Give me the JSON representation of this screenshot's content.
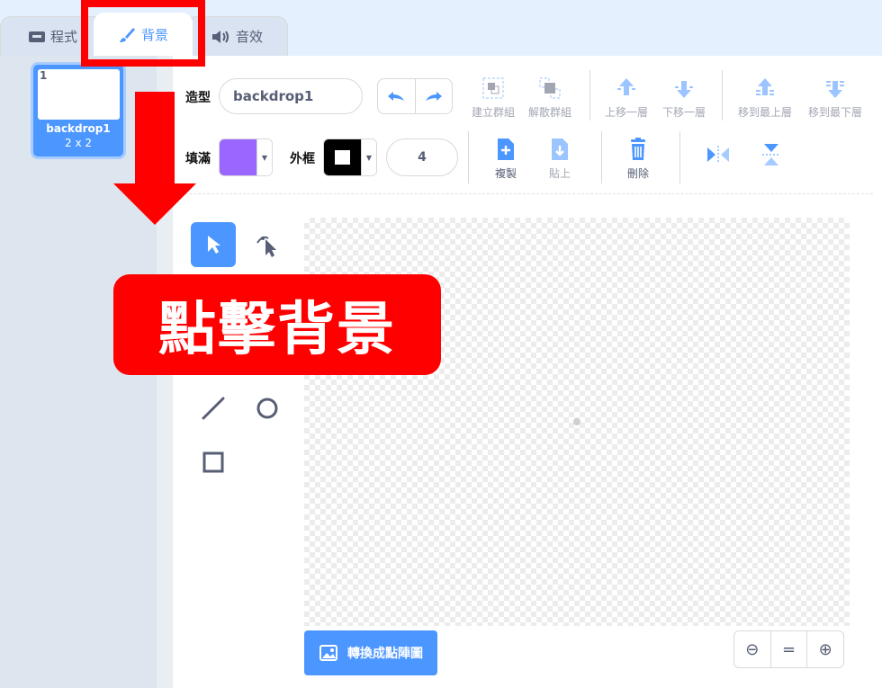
{
  "tabs": {
    "code": "程式",
    "backdrops": "背景",
    "sounds": "音效"
  },
  "asset": {
    "index": "1",
    "name": "backdrop1",
    "size": "2 x 2"
  },
  "toolbar": {
    "costume_label": "造型",
    "costume_name": "backdrop1",
    "group": "建立群組",
    "ungroup": "解散群組",
    "forward": "上移一層",
    "backward": "下移一層",
    "front": "移到最上層",
    "back": "移到最下層",
    "fill_label": "填滿",
    "outline_label": "外框",
    "stroke_width": "4",
    "copy": "複製",
    "paste": "貼上",
    "delete": "刪除"
  },
  "colors": {
    "fill": "#9966ff",
    "outline": "#000000",
    "accent": "#4c97ff",
    "highlight": "#ff0000"
  },
  "bottom": {
    "convert": "轉換成點陣圖",
    "zoom_out": "⊖",
    "zoom_reset": "=",
    "zoom_in": "⊕"
  },
  "annotation": {
    "callout": "點擊背景"
  }
}
